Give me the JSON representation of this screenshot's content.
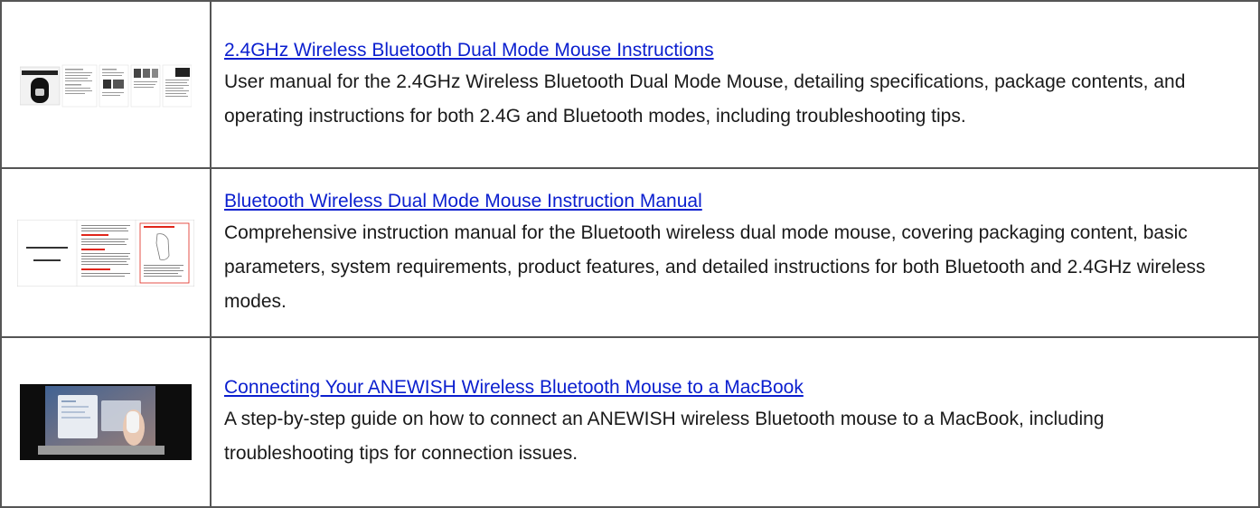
{
  "items": [
    {
      "title": "2.4GHz Wireless Bluetooth Dual Mode Mouse Instructions",
      "description": "User manual for the 2.4GHz Wireless Bluetooth Dual Mode Mouse, detailing specifications, package contents, and operating instructions for both 2.4G and Bluetooth modes, including troubleshooting tips.",
      "thumbnail": "manual-pages-thumbnail"
    },
    {
      "title": "Bluetooth Wireless Dual Mode Mouse Instruction Manual",
      "description": "Comprehensive instruction manual for the Bluetooth wireless dual mode mouse, covering packaging content, basic parameters, system requirements, product features, and detailed instructions for both Bluetooth and 2.4GHz wireless modes.",
      "thumbnail": "instruction-manual-thumbnail"
    },
    {
      "title": "Connecting Your ANEWISH Wireless Bluetooth Mouse to a MacBook",
      "description": "A step-by-step guide on how to connect an ANEWISH wireless Bluetooth mouse to a MacBook, including troubleshooting tips for connection issues.",
      "thumbnail": "video-frame-thumbnail"
    }
  ],
  "colors": {
    "link": "#0b1fcf",
    "text": "#1a1a1a",
    "border": "#555555",
    "manual_accent": "#e0261b"
  }
}
